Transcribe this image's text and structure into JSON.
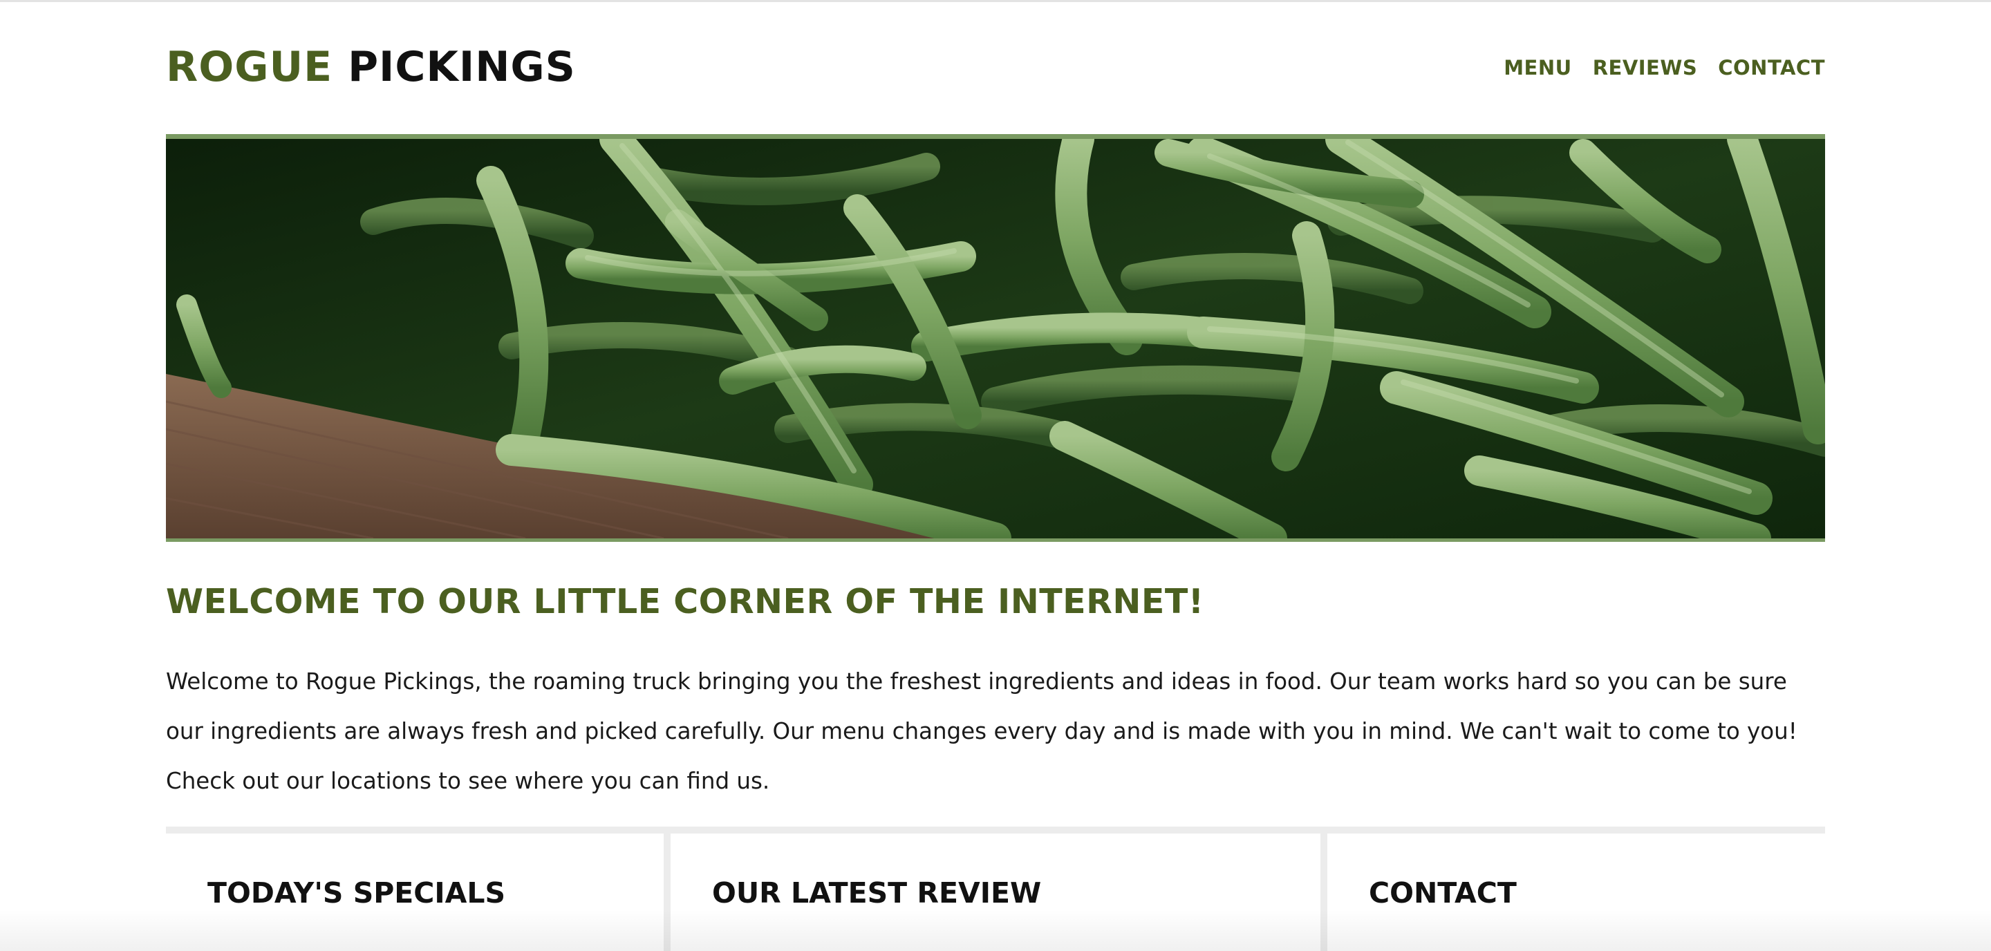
{
  "site": {
    "logo_accent": "ROGUE",
    "logo_rest": "PICKINGS"
  },
  "nav": {
    "items": [
      {
        "label": "MENU"
      },
      {
        "label": "REVIEWS"
      },
      {
        "label": "CONTACT"
      }
    ]
  },
  "hero": {
    "image": "green-beans-photo"
  },
  "welcome": {
    "title": "WELCOME TO OUR LITTLE CORNER OF THE INTERNET!",
    "text": "Welcome to Rogue Pickings, the roaming truck bringing you the freshest ingredients and ideas in food. Our team works hard so you can be sure our ingredients are always fresh and picked carefully. Our menu changes every day and is made with you in mind. We can't wait to come to you! Check out our locations to see where you can find us."
  },
  "cards": [
    {
      "title": "TODAY'S SPECIALS"
    },
    {
      "title": "OUR LATEST REVIEW"
    },
    {
      "title": "CONTACT"
    }
  ],
  "colors": {
    "accent": "#4b5f20",
    "hero_border": "#7a9a62",
    "text": "#1a1a1a",
    "divider": "#ececec"
  }
}
